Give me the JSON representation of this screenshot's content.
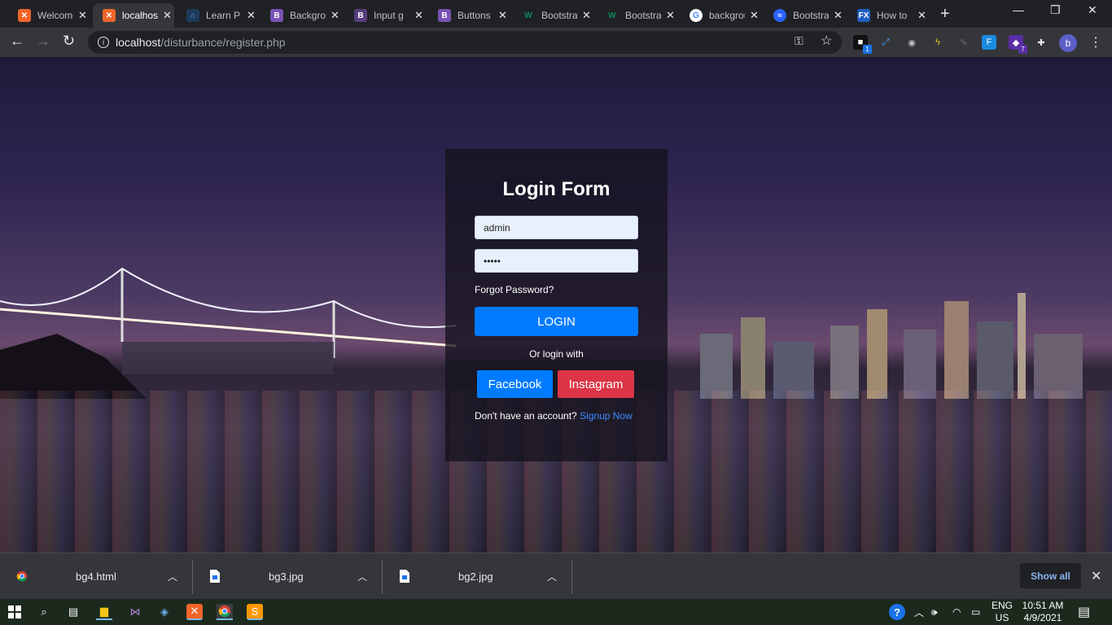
{
  "browser": {
    "tabs": [
      {
        "title": "Welcome",
        "favicon_color": "#f06529",
        "favicon_glyph": "xampp-icon",
        "active": false
      },
      {
        "title": "localhost",
        "favicon_color": "#f06529",
        "favicon_glyph": "xampp-icon",
        "active": true
      },
      {
        "title": "Learn P",
        "favicon_color": "#1e3a5a",
        "favicon_glyph": "code-icon",
        "active": false
      },
      {
        "title": "Background",
        "favicon_color": "#7952b3",
        "favicon_glyph": "bootstrap-icon",
        "active": false
      },
      {
        "title": "Input g",
        "favicon_color": "#563d7c",
        "favicon_glyph": "bootstrap-icon",
        "active": false
      },
      {
        "title": "Buttons",
        "favicon_color": "#7952b3",
        "favicon_glyph": "bootstrap-icon",
        "active": false
      },
      {
        "title": "Bootstrap",
        "favicon_color": "#0a8a5c",
        "favicon_glyph": "w3-icon",
        "active": false
      },
      {
        "title": "Bootstrap",
        "favicon_color": "#0a8a5c",
        "favicon_glyph": "w3-icon",
        "active": false
      },
      {
        "title": "background",
        "favicon_color": "#ffffff",
        "favicon_glyph": "google-icon",
        "active": false
      },
      {
        "title": "Bootstrap",
        "favicon_color": "#2962ff",
        "favicon_glyph": "tutorial-icon",
        "active": false
      },
      {
        "title": "How to",
        "favicon_color": "#1f5fbf",
        "favicon_glyph": "fx-icon",
        "active": false
      }
    ],
    "url_host": "localhost",
    "url_path": "/disturbance/register.php",
    "profile_initial": "b",
    "ext_badges": {
      "first": "1",
      "second": "7"
    }
  },
  "login": {
    "title": "Login Form",
    "username_value": "admin",
    "password_value": "•••••",
    "forgot_label": "Forgot Password?",
    "login_label": "LOGIN",
    "or_text": "Or login with",
    "facebook_label": "Facebook",
    "instagram_label": "Instagram",
    "no_account_text": "Don't have an account?",
    "signup_label": "Signup Now"
  },
  "downloads": {
    "items": [
      {
        "name": "bg4.html",
        "icon": "chrome-icon"
      },
      {
        "name": "bg3.jpg",
        "icon": "file-icon"
      },
      {
        "name": "bg2.jpg",
        "icon": "file-icon"
      }
    ],
    "show_all_label": "Show all"
  },
  "taskbar": {
    "language": "ENG",
    "region": "US",
    "time": "10:51 AM",
    "date": "4/9/2021"
  },
  "colors": {
    "primary": "#007bff",
    "danger": "#dc3545",
    "link": "#3d8bff"
  }
}
